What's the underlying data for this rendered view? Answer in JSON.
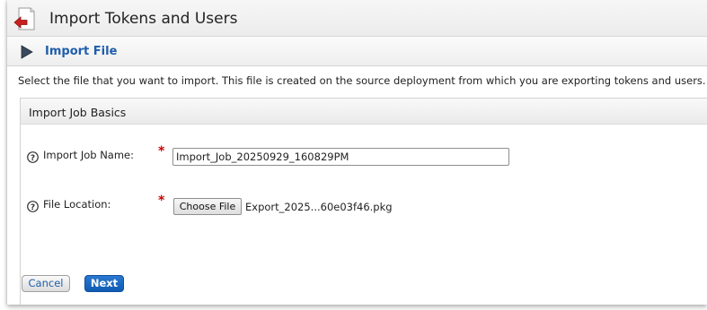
{
  "window": {
    "title": "Import Tokens and Users",
    "icon": "import-document-icon"
  },
  "section": {
    "title": "Import File",
    "icon": "play-triangle-icon"
  },
  "description": "Select the file that you want to import. This file is created on the source deployment from which you are exporting tokens and users.",
  "import_job_basics": {
    "title": "Import Job Basics",
    "job_name": {
      "label": "Import Job Name:",
      "required_marker": "*",
      "value": "Import_Job_20250929_160829PM",
      "help_icon": "help-question-icon"
    },
    "file_location": {
      "label": "File Location:",
      "required_marker": "*",
      "button_label": "Choose File",
      "file_name": "Export_2025...60e03f46.pkg",
      "help_icon": "help-question-icon"
    }
  },
  "footer": {
    "cancel_label": "Cancel",
    "next_label": "Next"
  },
  "colors": {
    "accent_blue": "#1f5eaa",
    "primary_button": "#1565c0",
    "required_red": "#cc0000",
    "app_icon_red": "#c8201e"
  }
}
